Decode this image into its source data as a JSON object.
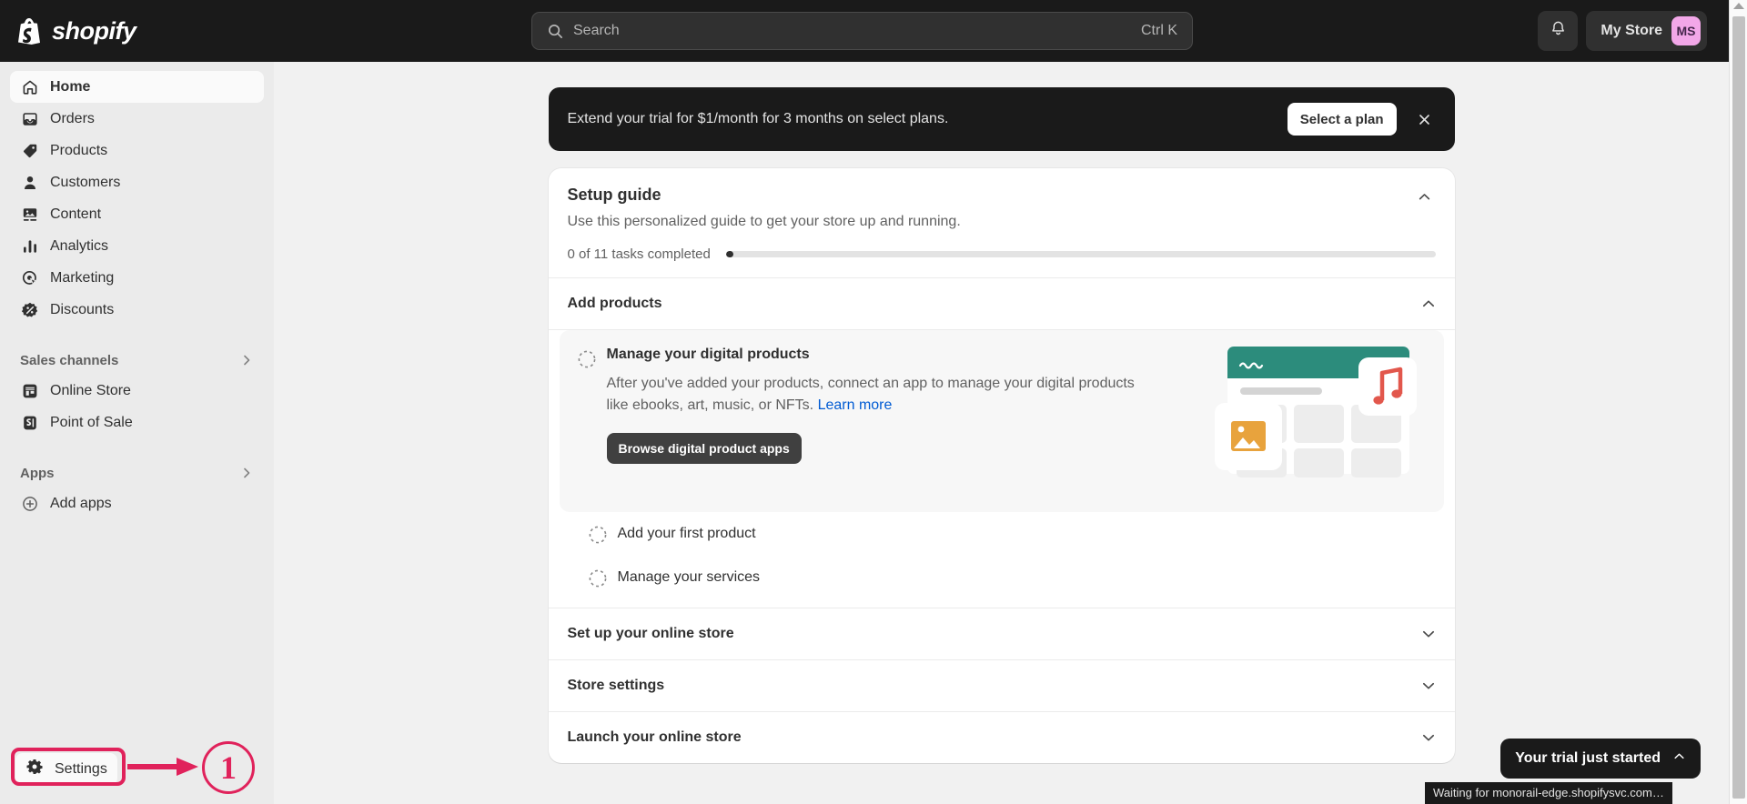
{
  "topbar": {
    "brand": "shopify",
    "brand_logo_icon": "shopify-bag-icon",
    "search": {
      "icon": "search-icon",
      "placeholder": "Search",
      "value": "",
      "shortcut": "Ctrl K"
    },
    "notifications_icon": "bell-icon",
    "store_name": "My Store",
    "avatar_initials": "MS",
    "avatar_color": "#F2A7E8"
  },
  "sidebar": {
    "items": [
      {
        "label": "Home",
        "icon": "home-icon",
        "active": true
      },
      {
        "label": "Orders",
        "icon": "orders-inbox-icon",
        "active": false
      },
      {
        "label": "Products",
        "icon": "product-tag-icon",
        "active": false
      },
      {
        "label": "Customers",
        "icon": "person-icon",
        "active": false
      },
      {
        "label": "Content",
        "icon": "content-image-icon",
        "active": false
      },
      {
        "label": "Analytics",
        "icon": "bar-chart-icon",
        "active": false
      },
      {
        "label": "Marketing",
        "icon": "marketing-target-icon",
        "active": false
      },
      {
        "label": "Discounts",
        "icon": "discount-percent-icon",
        "active": false
      }
    ],
    "sales_channels": {
      "label": "Sales channels",
      "chevron_icon": "chevron-right-icon",
      "items": [
        {
          "label": "Online Store",
          "icon": "storefront-icon"
        },
        {
          "label": "Point of Sale",
          "icon": "point-of-sale-icon"
        }
      ]
    },
    "apps": {
      "label": "Apps",
      "chevron_icon": "chevron-right-icon",
      "items": [
        {
          "label": "Add apps",
          "icon": "plus-circle-icon"
        }
      ]
    },
    "settings": {
      "label": "Settings",
      "icon": "gear-icon"
    }
  },
  "annotation": {
    "step_number": "1",
    "color": "#E0225B",
    "arrow_icon": "arrow-right-icon",
    "highlight_target": "Settings"
  },
  "trial_banner": {
    "message": "Extend your trial for $1/month for 3 months on select plans.",
    "cta_label": "Select a plan",
    "close_icon": "close-icon"
  },
  "setup_guide": {
    "title": "Setup guide",
    "subtitle": "Use this personalized guide to get your store up and running.",
    "progress_label": "0 of 11 tasks completed",
    "tasks_completed": 0,
    "tasks_total": 11,
    "progress_percent": 0,
    "collapse_icon": "chevron-up-icon"
  },
  "sections": [
    {
      "title": "Add products",
      "expanded": true,
      "chevron_icon": "chevron-up-icon",
      "active_task": {
        "title": "Manage your digital products",
        "checkbox_icon": "dashed-circle-icon",
        "description": "After you've added your products, connect an app to manage your digital products like ebooks, art, music, or NFTs.",
        "link_label": "Learn more",
        "button_label": "Browse digital product apps",
        "illustration": {
          "name": "digital-products-illustration",
          "header_color": "#2C8C7C",
          "image_card_color": "#E8A33D",
          "music_card_color": "#E2574C"
        }
      },
      "tasks": [
        {
          "label": "Add your first product",
          "checkbox_icon": "dashed-circle-icon"
        },
        {
          "label": "Manage your services",
          "checkbox_icon": "dashed-circle-icon"
        }
      ]
    },
    {
      "title": "Set up your online store",
      "expanded": false,
      "chevron_icon": "chevron-down-icon"
    },
    {
      "title": "Store settings",
      "expanded": false,
      "chevron_icon": "chevron-down-icon"
    },
    {
      "title": "Launch your online store",
      "expanded": false,
      "chevron_icon": "chevron-down-icon"
    }
  ],
  "trial_pill": {
    "label": "Your trial just started",
    "chevron_icon": "chevron-up-icon"
  },
  "status_bar": {
    "text": "Waiting for monorail-edge.shopifysvc.com…"
  }
}
